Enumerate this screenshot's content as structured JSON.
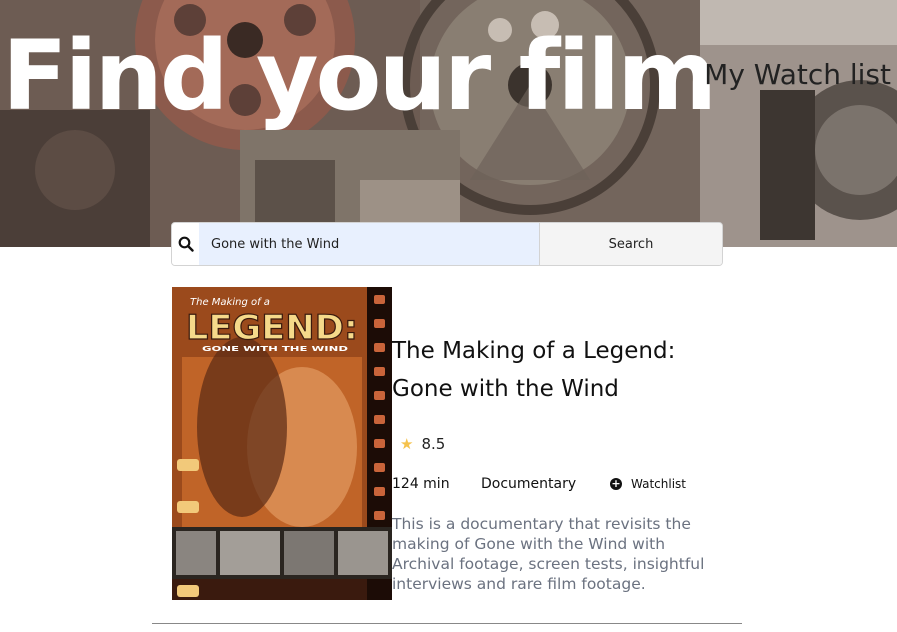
{
  "header": {
    "title": "Find your film",
    "watchlist_link": "My Watch list"
  },
  "search": {
    "value": "Gone with the Wind",
    "button_label": "Search"
  },
  "result": {
    "poster": {
      "top_text": "The Making of a",
      "main_text": "LEGEND:",
      "sub_text": "GONE WITH THE WIND"
    },
    "title": "The Making of a Legend: Gone with the Wind",
    "rating": "8.5",
    "runtime": "124 min",
    "genre": "Documentary",
    "watchlist_label": "Watchlist",
    "plot": "This is a documentary that revisits the making of Gone with the Wind with Archival footage, screen tests, insightful interviews and rare film footage."
  },
  "icons": {
    "search": "search-icon",
    "rating": "star-icon",
    "watchlist": "plus-circle-icon"
  },
  "colors": {
    "star": "#f5c24c",
    "plot_text": "#6b7280",
    "input_bg": "#e8f0fe"
  }
}
